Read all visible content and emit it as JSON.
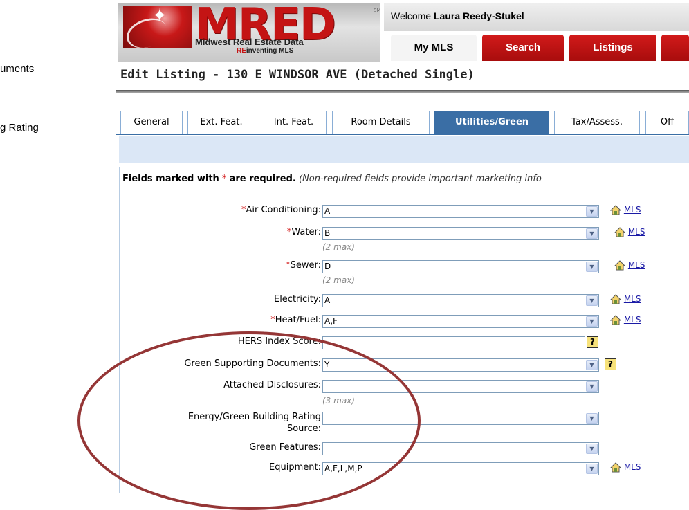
{
  "side_fragments": [
    "uments",
    "g Rating"
  ],
  "header": {
    "logo_word": "MRED",
    "logo_tm": "SM",
    "logo_line1": "Midwest Real Estate Data",
    "logo_line2_re": "RE",
    "logo_line2_rest": "inventing MLS",
    "welcome_prefix": "Welcome ",
    "welcome_user": "Laura Reedy-Stukel",
    "nav": [
      "My MLS",
      "Search",
      "Listings"
    ]
  },
  "page_title": "Edit Listing - 130 E WINDSOR AVE (Detached Single)",
  "tabs": [
    "General",
    "Ext. Feat.",
    "Int. Feat.",
    "Room Details",
    "Utilities/Green",
    "Tax/Assess.",
    "Off"
  ],
  "required_note": {
    "bold_prefix": "Fields marked with",
    "star": "*",
    "bold_suffix": "are required.",
    "italic": "(Non-required fields provide important marketing info"
  },
  "fields": {
    "air_conditioning": {
      "label": "Air Conditioning:",
      "value": "A",
      "link": "MLS"
    },
    "water": {
      "label": "Water:",
      "value": "B",
      "max": "(2 max)",
      "link": "MLS"
    },
    "sewer": {
      "label": "Sewer:",
      "value": "D",
      "max": "(2 max)",
      "link": "MLS"
    },
    "electricity": {
      "label": "Electricity:",
      "value": "A",
      "link": "MLS"
    },
    "heat_fuel": {
      "label": "Heat/Fuel:",
      "value": "A,F",
      "link": "MLS"
    },
    "hers": {
      "label": "HERS Index Score:",
      "value": "",
      "help": "?"
    },
    "green_docs": {
      "label": "Green Supporting Documents:",
      "value": "Y",
      "help": "?"
    },
    "attached_disclosures": {
      "label": "Attached Disclosures:",
      "value": "",
      "max": "(3 max)"
    },
    "energy_rating": {
      "label_line1": "Energy/Green Building Rating",
      "label_line2": "Source:",
      "value": ""
    },
    "green_features": {
      "label": "Green Features:",
      "value": ""
    },
    "equipment": {
      "label": "Equipment:",
      "value": "A,F,L,M,P",
      "link": "MLS"
    }
  },
  "colors": {
    "brand_red": "#c41414",
    "tab_active": "#3a6ea5",
    "annotation": "#953636"
  }
}
